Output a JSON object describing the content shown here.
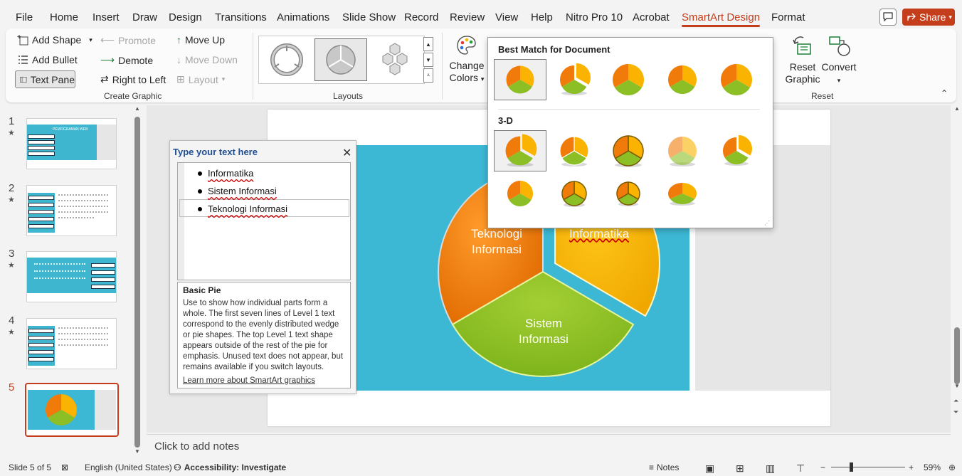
{
  "menu": {
    "items": [
      "File",
      "Home",
      "Insert",
      "Draw",
      "Design",
      "Transitions",
      "Animations",
      "Slide Show",
      "Record",
      "Review",
      "View",
      "Help",
      "Nitro Pro 10",
      "Acrobat",
      "SmartArt Design",
      "Format"
    ],
    "active": "SmartArt Design",
    "share_label": "Share"
  },
  "ribbon": {
    "create_graphic": {
      "add_shape": "Add Shape",
      "add_bullet": "Add Bullet",
      "text_pane": "Text Pane",
      "promote": "Promote",
      "demote": "Demote",
      "right_to_left": "Right to Left",
      "move_up": "Move Up",
      "move_down": "Move Down",
      "layout": "Layout",
      "group_label": "Create Graphic"
    },
    "layouts": {
      "group_label": "Layouts"
    },
    "change_colors_line1": "Change",
    "change_colors_line2": "Colors",
    "reset": {
      "reset_graphic_line1": "Reset",
      "reset_graphic_line2": "Graphic",
      "convert": "Convert",
      "group_label": "Reset"
    }
  },
  "gallery": {
    "best_match_heading": "Best Match for Document",
    "three_d_heading": "3-D"
  },
  "slides": {
    "numbers": [
      "1",
      "2",
      "3",
      "4",
      "5"
    ],
    "current": "5",
    "slide1_title": "PEMOGRAMAN WEB"
  },
  "smartart": {
    "segments": [
      "Informatika",
      "Sistem Informasi",
      "Teknologi Informasi"
    ],
    "colors": {
      "informatika": "#f9b300",
      "sistem": "#8cbf26",
      "teknologi": "#f07b0a"
    }
  },
  "text_pane": {
    "title": "Type your text here",
    "items": [
      "Informatika",
      "Sistem Informasi",
      "Teknologi Informasi"
    ],
    "desc_title": "Basic Pie",
    "desc_text": "Use to show how individual parts form a whole. The first seven lines of Level 1 text correspond to the evenly distributed wedge or pie shapes. The top Level 1 text shape appears outside of the rest of the pie for emphasis. Unused text does not appear, but remains available if you switch layouts.",
    "learn_more": "Learn more about SmartArt graphics"
  },
  "notes": {
    "placeholder": "Click to add notes"
  },
  "status": {
    "slide_info": "Slide 5 of 5",
    "language": "English (United States)",
    "accessibility": "Accessibility: Investigate",
    "notes_label": "Notes",
    "zoom": "59%"
  }
}
